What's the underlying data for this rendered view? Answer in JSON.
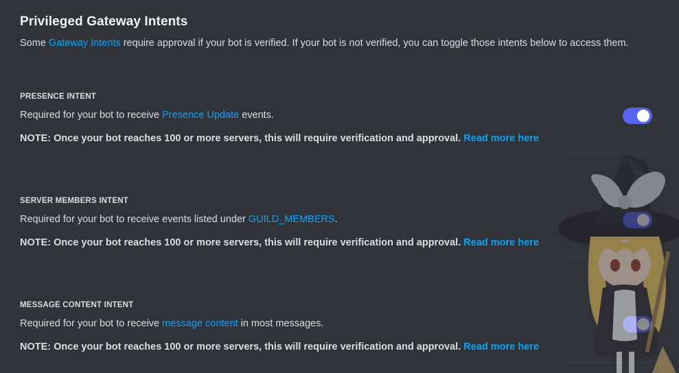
{
  "header": {
    "title": "Privileged Gateway Intents",
    "desc_before": "Some ",
    "desc_link": "Gateway Intents",
    "desc_after": " require approval if your bot is verified. If your bot is not verified, you can toggle those intents below to access them."
  },
  "intents": [
    {
      "label": "PRESENCE INTENT",
      "desc_before": "Required for your bot to receive ",
      "desc_link": "Presence Update",
      "desc_after": " events.",
      "note": "NOTE: Once your bot reaches 100 or more servers, this will require verification and approval.",
      "note_link": "Read more here",
      "enabled": true
    },
    {
      "label": "SERVER MEMBERS INTENT",
      "desc_before": "Required for your bot to receive events listed under ",
      "desc_link": "GUILD_MEMBERS",
      "desc_after": ".",
      "note": "NOTE: Once your bot reaches 100 or more servers, this will require verification and approval.",
      "note_link": "Read more here",
      "enabled": true
    },
    {
      "label": "MESSAGE CONTENT INTENT",
      "desc_before": "Required for your bot to receive ",
      "desc_link": "message content",
      "desc_after": " in most messages.",
      "note": "NOTE: Once your bot reaches 100 or more servers, this will require verification and approval.",
      "note_link": "Read more here",
      "enabled": true
    }
  ],
  "colors": {
    "background": "#313338",
    "text": "#dbdee1",
    "link": "#00a8fc",
    "toggle_on": "#5865f2"
  },
  "icons": {
    "decorative_character": "witch-mascot-icon"
  }
}
